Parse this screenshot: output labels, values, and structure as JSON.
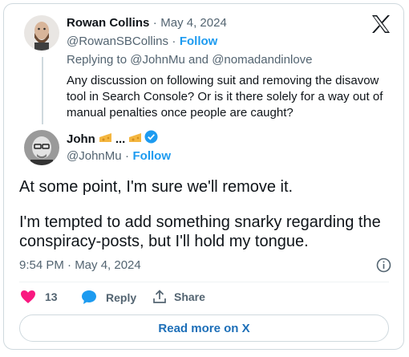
{
  "reply_tweet": {
    "author_name": "Rowan Collins",
    "separator": "·",
    "date": "May 4, 2024",
    "handle": "@RowanSBCollins",
    "follow_label": "Follow",
    "replying_prefix": "Replying to",
    "replying_user1": "@JohnMu",
    "replying_and": "and",
    "replying_user2": "@nomadandinlove",
    "text_line1": "Any discussion on following suit and removing the disavow",
    "text_line2": "tool in Search Console? Or is it there solely for a way out of",
    "text_line3": "manual penalties once people are caught?"
  },
  "main_tweet": {
    "author_name": "John",
    "name_suffix": "...",
    "handle": "@JohnMu",
    "separator": "·",
    "follow_label": "Follow",
    "text_line1": "At some point, I'm sure we'll remove it.",
    "text_line2": "I'm tempted to add something snarky regarding the",
    "text_line3": "conspiracy-posts, but I'll hold my tongue.",
    "timestamp": "9:54 PM · May 4, 2024"
  },
  "actions": {
    "like_count": "13",
    "reply_label": "Reply",
    "share_label": "Share"
  },
  "read_more_label": "Read more on X",
  "colors": {
    "accent": "#1d9bf0",
    "like": "#f91880",
    "verified": "#1d9bf0"
  }
}
